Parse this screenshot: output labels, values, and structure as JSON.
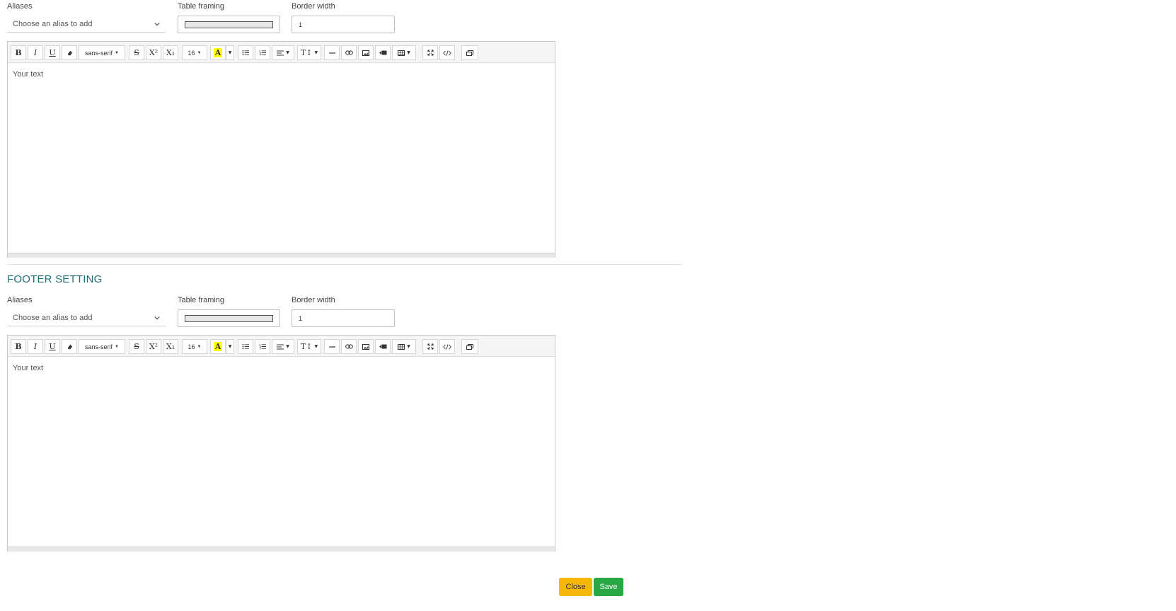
{
  "header_section": {
    "aliases_label": "Aliases",
    "aliases_placeholder": "Choose an alias to add",
    "framing_label": "Table framing",
    "border_label": "Border width",
    "border_value": "1",
    "editor_text": "Your text"
  },
  "footer_section": {
    "title": "FOOTER SETTING",
    "aliases_label": "Aliases",
    "aliases_placeholder": "Choose an alias to add",
    "framing_label": "Table framing",
    "border_label": "Border width",
    "border_value": "1",
    "editor_text": "Your text"
  },
  "toolbar": {
    "bold": "B",
    "italic": "I",
    "underline": "U",
    "font_name": "sans-serif",
    "superscript": "X²",
    "subscript": "X₁",
    "font_size": "16",
    "color": "A",
    "height": "T↕"
  },
  "icons": [
    "bold-icon",
    "italic-icon",
    "underline-icon",
    "eraser-icon",
    "strikethrough-icon",
    "superscript-icon",
    "subscript-icon",
    "font-color-icon",
    "unordered-list-icon",
    "ordered-list-icon",
    "align-icon",
    "line-height-icon",
    "horizontal-rule-icon",
    "link-icon",
    "picture-icon",
    "video-icon",
    "table-icon",
    "fullscreen-icon",
    "code-view-icon",
    "help-icon"
  ],
  "colors": {
    "close": "#f5b80a",
    "save": "#28a745",
    "title": "#1f6f7a",
    "highlight": "#ffff00"
  },
  "actions": {
    "close_label": "Close",
    "save_label": "Save"
  }
}
